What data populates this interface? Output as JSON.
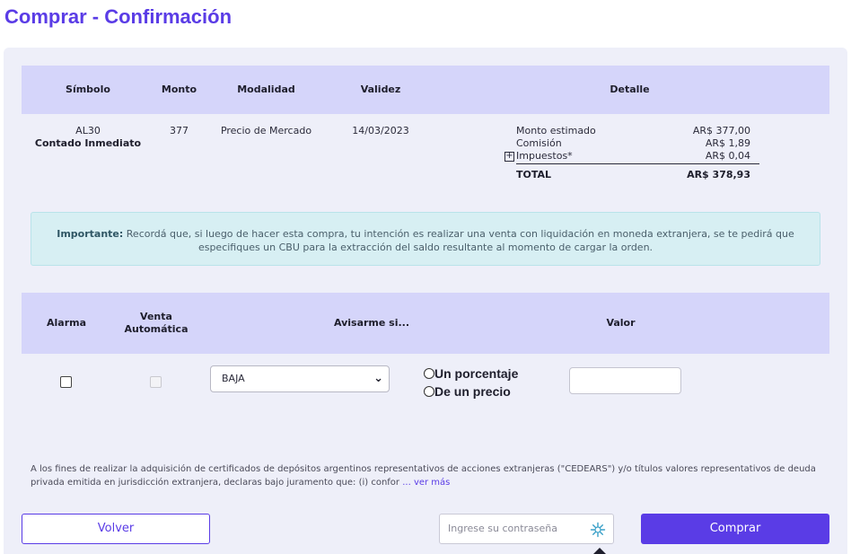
{
  "page": {
    "title": "Comprar - Confirmación"
  },
  "order_table": {
    "headers": [
      "Símbolo",
      "Monto",
      "Modalidad",
      "Validez",
      "Detalle"
    ],
    "row": {
      "symbol": "AL30",
      "settlement": "Contado Inmediato",
      "amount": "377",
      "modality": "Precio de Mercado",
      "validity": "14/03/2023"
    },
    "detail": {
      "estimated_label": "Monto estimado",
      "estimated_value": "AR$ 377,00",
      "commission_label": "Comisión",
      "commission_value": "AR$ 1,89",
      "taxes_label": "Impuestos*",
      "taxes_value": "AR$ 0,04",
      "total_label": "TOTAL",
      "total_value": "AR$ 378,93"
    }
  },
  "notice": {
    "label": "Importante:",
    "text": "Recordá que, si luego de hacer esta compra, tu intención es realizar una venta con liquidación en moneda extranjera, se te pedirá que especifiques un CBU para la extracción del saldo resultante al momento de cargar la orden."
  },
  "alarm_table": {
    "headers": {
      "alarm": "Alarma",
      "auto_sell_1": "Venta",
      "auto_sell_2": "Automática",
      "notify": "Avisarme si...",
      "value": "Valor"
    },
    "condition_selected": "BAJA",
    "radio_percentage": "Un porcentaje",
    "radio_price": "De un precio"
  },
  "disclaimer": {
    "text": "A los fines de realizar la adquisición de certificados de depósitos argentinos representativos de acciones extranjeras (\"CEDEARS\") y/o títulos valores representativos de deuda privada emitida en jurisdicción extranjera, declaras bajo juramento que: (i) confor",
    "more": "... ver más"
  },
  "footer": {
    "back_label": "Volver",
    "password_placeholder": "Ingrese su contraseña",
    "buy_label": "Comprar"
  },
  "colors": {
    "accent": "#5a3ce6",
    "header_bg": "#d5d5fa",
    "card_bg": "#eeeff9",
    "notice_bg": "#d7eff3"
  }
}
